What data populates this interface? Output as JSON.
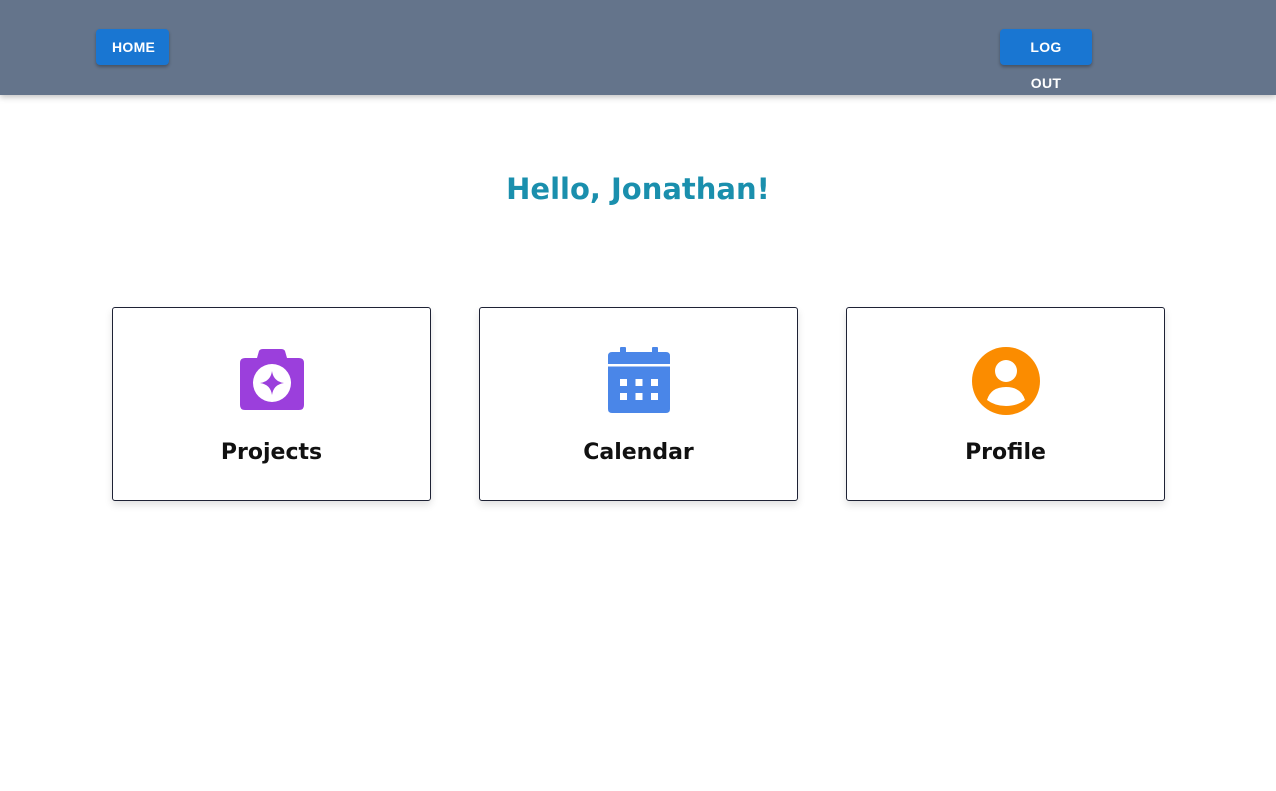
{
  "header": {
    "home_label": "HOME",
    "logout_label": "LOG OUT"
  },
  "main": {
    "greeting": "Hello, Jonathan!",
    "cards": [
      {
        "label": "Projects",
        "icon": "camera-icon",
        "icon_color": "#9b3fdc"
      },
      {
        "label": "Calendar",
        "icon": "calendar-icon",
        "icon_color": "#4a86e8"
      },
      {
        "label": "Profile",
        "icon": "person-icon",
        "icon_color": "#fb8c00"
      }
    ]
  },
  "colors": {
    "header_bg": "#64748b",
    "button_bg": "#1976d2",
    "greeting": "#1a8fad"
  }
}
